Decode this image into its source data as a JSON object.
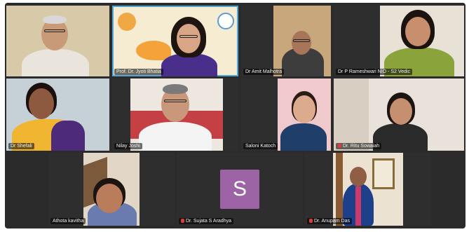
{
  "meeting": {
    "participants": [
      {
        "name": ""
      },
      {
        "name": "Prof. Dr. Jyoti Bhatia"
      },
      {
        "name": "Dr Amit Malhotra"
      },
      {
        "name": "Dr P Rameshwari NIO - S2 Vedic"
      },
      {
        "name": "Dr Shefali"
      },
      {
        "name": "Nilay Joshi"
      },
      {
        "name": "Saloni Katoch"
      },
      {
        "name": "Dr. Ritu Sowaiah"
      },
      {
        "name": "Athota kavitha"
      },
      {
        "name": "Dr. Sujata S Aradhya"
      },
      {
        "name": "Dr. Anupam Das"
      }
    ],
    "avatar_initial": "S",
    "colors": {
      "background": "#2b2b2b",
      "active_speaker": "#4fa8d8",
      "muted_mic": "#e23b3b",
      "avatar": "#9c63a5"
    }
  }
}
